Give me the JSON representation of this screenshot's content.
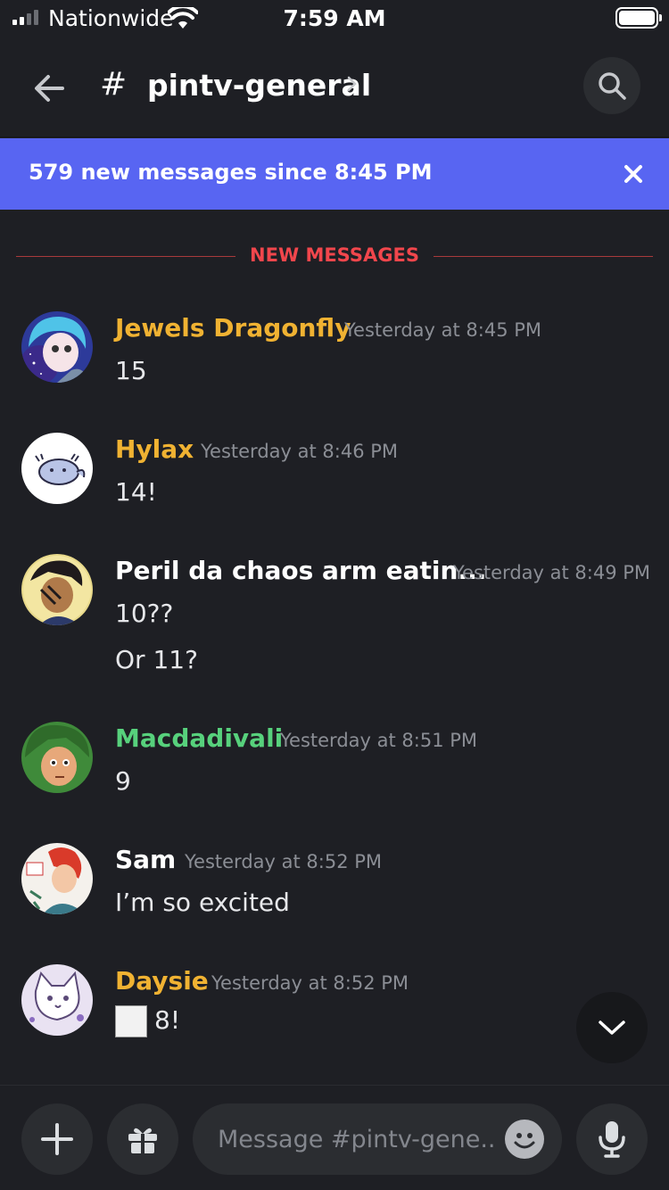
{
  "status_bar": {
    "carrier": "Nationwide",
    "time": "7:59 AM",
    "signal_bars": 2,
    "battery_level": 1.0
  },
  "header": {
    "channel_name": "pintv-general",
    "hash_symbol": "#"
  },
  "banner": {
    "text": "579 new messages since 8:45 PM",
    "color": "#5865f2"
  },
  "divider": {
    "label": "NEW MESSAGES",
    "color": "#f1464c"
  },
  "messages": [
    {
      "author": "Jewels Dragonfly",
      "author_color": "#f0b232",
      "timestamp": "Yesterday at 8:45 PM",
      "lines": [
        "15"
      ]
    },
    {
      "author": "Hylax",
      "author_color": "#f0b232",
      "timestamp": "Yesterday at 8:46 PM",
      "lines": [
        "14!"
      ]
    },
    {
      "author": "Peril da chaos arm eatin...",
      "author_color": "#ffffff",
      "timestamp": "Yesterday at 8:49 PM",
      "lines": [
        "10??",
        "Or 11?"
      ]
    },
    {
      "author": "Macdadivali",
      "author_color": "#57d17c",
      "timestamp": "Yesterday at 8:51 PM",
      "lines": [
        "9"
      ]
    },
    {
      "author": "Sam",
      "author_color": "#ffffff",
      "timestamp": "Yesterday at 8:52 PM",
      "lines": [
        "I’m so excited"
      ]
    },
    {
      "author": "Daysie",
      "author_color": "#f0b232",
      "timestamp": "Yesterday at 8:52 PM",
      "lines": [
        "8!"
      ]
    }
  ],
  "composer": {
    "placeholder": "Message #pintv-gene..."
  },
  "icons": {
    "back": "arrow-left-icon",
    "search": "search-icon",
    "close": "close-icon",
    "scroll_down": "chevron-down-icon",
    "add": "plus-icon",
    "gift": "gift-icon",
    "emoji": "emoji-icon",
    "mic": "microphone-icon"
  }
}
